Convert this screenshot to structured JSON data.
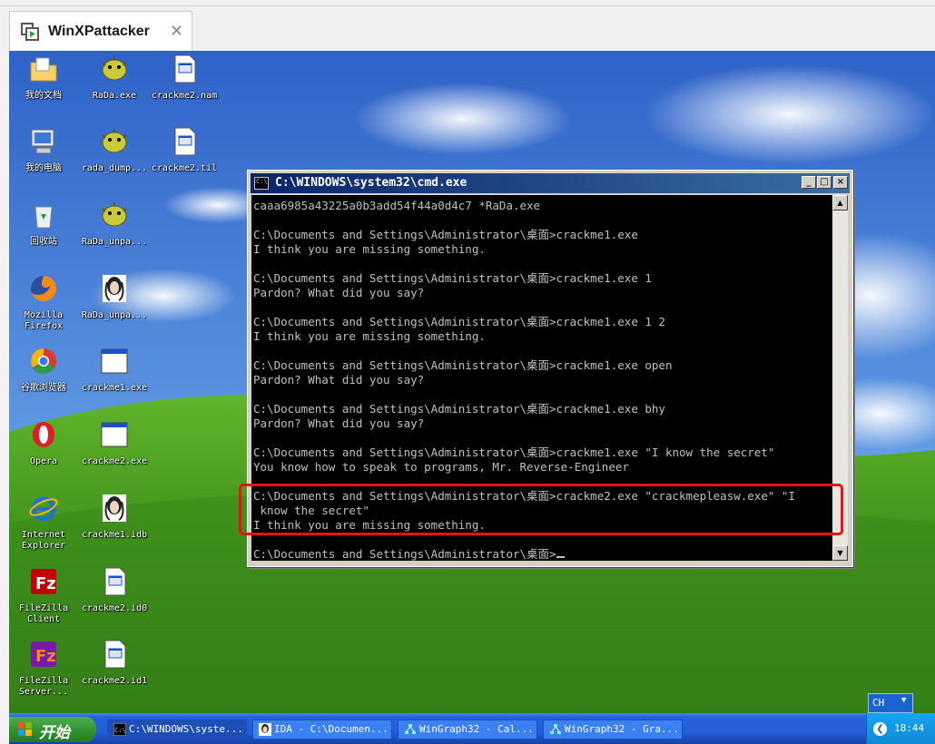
{
  "host": {
    "tab_title": "WinXPattacker",
    "close_glyph": "✕"
  },
  "desktop": {
    "icons": [
      {
        "label": "我的文档",
        "icon": "my-documents-folder-icon"
      },
      {
        "label": "我的电脑",
        "icon": "my-computer-icon"
      },
      {
        "label": "回收站",
        "icon": "recycle-bin-icon"
      },
      {
        "label": "Mozilla\nFirefox",
        "icon": "firefox-icon"
      },
      {
        "label": "谷歌浏览器",
        "icon": "chrome-icon"
      },
      {
        "label": "Opera",
        "icon": "opera-icon"
      },
      {
        "label": "Internet\nExplorer",
        "icon": "internet-explorer-icon"
      },
      {
        "label": "FileZilla\nClient",
        "icon": "filezilla-icon"
      },
      {
        "label": "FileZilla\nServer...",
        "icon": "filezilla-server-icon"
      },
      {
        "label": "RaDa.exe",
        "icon": "pufferfish-icon"
      },
      {
        "label": "rada_dump...",
        "icon": "pufferfish-icon"
      },
      {
        "label": "RaDa_unpa...",
        "icon": "pufferfish-icon"
      },
      {
        "label": "RaDa_unpa...",
        "icon": "ida-database-icon"
      },
      {
        "label": "crackme1.exe",
        "icon": "exe-window-icon"
      },
      {
        "label": "crackme2.exe",
        "icon": "exe-window-icon"
      },
      {
        "label": "crackme1.idb",
        "icon": "ida-database-icon"
      },
      {
        "label": "crackme2.id0",
        "icon": "document-icon"
      },
      {
        "label": "crackme2.id1",
        "icon": "document-icon"
      },
      {
        "label": "crackme2.nam",
        "icon": "document-icon"
      },
      {
        "label": "crackme2.til",
        "icon": "document-icon"
      }
    ]
  },
  "cmd": {
    "title": "C:\\WINDOWS\\system32\\cmd.exe",
    "icon_text": "C:\\",
    "minimize": "_",
    "maximize": "□",
    "close": "×",
    "lines": [
      "caaa6985a43225a0b3add54f44a0d4c7 *RaDa.exe",
      "",
      "C:\\Documents and Settings\\Administrator\\桌面>crackme1.exe",
      "I think you are missing something.",
      "",
      "C:\\Documents and Settings\\Administrator\\桌面>crackme1.exe 1",
      "Pardon? What did you say?",
      "",
      "C:\\Documents and Settings\\Administrator\\桌面>crackme1.exe 1 2",
      "I think you are missing something.",
      "",
      "C:\\Documents and Settings\\Administrator\\桌面>crackme1.exe open",
      "Pardon? What did you say?",
      "",
      "C:\\Documents and Settings\\Administrator\\桌面>crackme1.exe bhy",
      "Pardon? What did you say?",
      "",
      "C:\\Documents and Settings\\Administrator\\桌面>crackme1.exe \"I know the secret\"",
      "You know how to speak to programs, Mr. Reverse-Engineer",
      "",
      "C:\\Documents and Settings\\Administrator\\桌面>crackme2.exe \"crackmepleasw.exe\" \"I",
      " know the secret\"",
      "I think you are missing something.",
      "",
      "C:\\Documents and Settings\\Administrator\\桌面>"
    ]
  },
  "taskbar": {
    "start_label": "开始",
    "items": [
      {
        "label": "C:\\WINDOWS\\syste...",
        "icon": "cmd-icon",
        "active": true
      },
      {
        "label": "IDA - C:\\Documen...",
        "icon": "ida-icon",
        "active": false
      },
      {
        "label": "WinGraph32 - Cal...",
        "icon": "wingraph-icon",
        "active": false
      },
      {
        "label": "WinGraph32 - Gra...",
        "icon": "wingraph-icon",
        "active": false
      }
    ],
    "language": "CH",
    "clock": "18:44"
  },
  "colors": {
    "highlight": "#ee1111",
    "titlebar": "#0a246a",
    "taskbar": "#245edb"
  }
}
